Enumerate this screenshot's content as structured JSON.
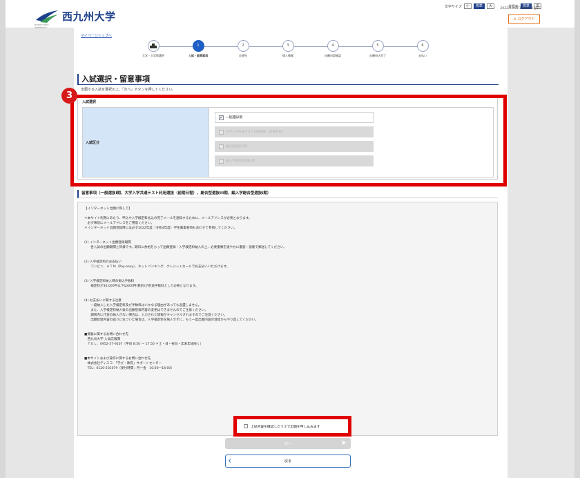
{
  "header": {
    "logo_text": "西九州大学",
    "logo_sub": "NISHIKYUSHU UNIVERSITY",
    "font_size_label": "文字サイズ",
    "font_sizes": [
      "小",
      "標準",
      "大"
    ],
    "bg_color_label": "背景色",
    "bg_colors": [
      "標準",
      "黒"
    ],
    "datetime": "2022/01/08 17:01:23 [JST]",
    "logout_label": "ログアウト"
  },
  "breadcrumb": {
    "mypage_link": "マイページトップへ"
  },
  "steps": [
    {
      "num": "",
      "label": "大学・大学院選択",
      "state": "done"
    },
    {
      "num": "1",
      "label": "入試・留意事項",
      "state": "active"
    },
    {
      "num": "2",
      "label": "志望先",
      "state": "todo"
    },
    {
      "num": "3",
      "label": "個人情報",
      "state": "todo"
    },
    {
      "num": "4",
      "label": "出願内容確認",
      "state": "todo"
    },
    {
      "num": "5",
      "label": "出願申込完了",
      "state": "todo"
    },
    {
      "num": "6",
      "label": "支払い",
      "state": "todo"
    }
  ],
  "page": {
    "title": "入試選択・留意事項",
    "instruction": "出願する入試を選択の上、「次へ」ボタンを押してください。"
  },
  "exam_selection": {
    "section_title": "入試選択",
    "row_label": "入試区分",
    "options": [
      {
        "label": "一般選抜I期",
        "checked": true,
        "disabled": false
      },
      {
        "label": "大学入学共通テスト利用選抜（前期日程）",
        "checked": false,
        "disabled": true
      },
      {
        "label": "総合型選抜III期",
        "checked": false,
        "disabled": true
      },
      {
        "label": "編入学総合型選抜I期",
        "checked": false,
        "disabled": true
      }
    ]
  },
  "notes": {
    "heading": "留意事項（一般選抜I期、大学入学共通テスト利用選抜（前期日程）、総合型選抜III期、編入学総合型選抜I期）",
    "lines": [
      "【インターネット出願に際して】",
      "",
      "＊本サイト利用にあたり、申込や入学検定料払込の完了メールを通知するために、メールアドレスが必要となります。",
      "　必ず事前にメールアドレスをご用意ください。",
      "＊インターネット出願登録時には必ず2022年度（令和4年度）学生募集要項もあわせて参照してください。",
      "",
      "",
      "(1) インターネット出願登録期間",
      "　　各入試の出願期間と同様です。期日に余裕をもって出願登録・入学検定料納入の上、必要書類を速やかに書留・速達で郵送してください。",
      "",
      "",
      "(2) 入学検定料のお支払い",
      "　　コンビニ、ＡＴＭ（Pay-easy）、ネットバンキング、クレジットカードでお支払いいただけます。",
      "",
      "",
      "(3) 入学検定料納入時の振込手数料",
      "　　検定料が30,000円以下は600円(税別)が別途手数料として必要となります。",
      "",
      "",
      "(4) お支払いに関する注意",
      "　　一度納入した入学検定料及び手数料はいかなる理由があっても返還しません。",
      "　　また、入学検定料納入後の出願登録内容の変更はできませんのでご注意ください。",
      "　　期限内に代金の納入がない場合は、入力された情報がキャンセルされますのでご注意ください。",
      "　　出願登録内容の誤りに気づいた場合は、入学検定料を納入せずに、もう一度出願内容の登録からやり直してください。",
      "",
      "",
      "■受験に関するお問い合わせ先",
      "　西九州大学 入試広報課",
      "　ＴＥＬ：0952-37-9207（平日 8:50 ～ 17:50 ＊土・日・祝日・年末年始除く）",
      "",
      "",
      "■本サイトおよび操作に関するお問い合わせ先",
      "　株式会社ディスコ　「学び・教育」サポートセンター",
      "　TEL：0120-202079（受付時間：月～金　10:00～18:00）"
    ]
  },
  "agree": {
    "label": "上記内容を確認したうえで出願を申し込みます",
    "checked": false
  },
  "buttons": {
    "next_label": "次へ",
    "back_label": "戻る"
  },
  "annotation": {
    "badge": "3"
  },
  "colors": {
    "brand": "#1d3f8a",
    "highlight": "#e00000",
    "logout": "#e8741b"
  }
}
